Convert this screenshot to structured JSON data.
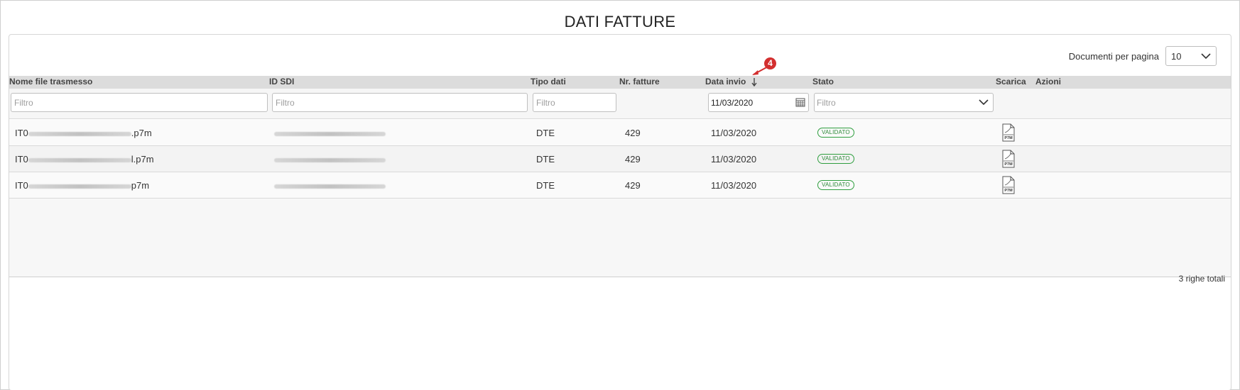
{
  "page": {
    "title": "DATI FATTURE"
  },
  "pagination": {
    "label": "Documenti per pagina",
    "selected": "10"
  },
  "columns": {
    "file_name": "Nome file trasmesso",
    "id_sdi": "ID SDI",
    "tipo_dati": "Tipo dati",
    "nr_fatture": "Nr. fatture",
    "data_invio": "Data invio",
    "stato": "Stato",
    "scarica": "Scarica",
    "azioni": "Azioni"
  },
  "sort_annotation": {
    "marker": "4",
    "color": "#d32f2f"
  },
  "filters": {
    "file_name_placeholder": "Filtro",
    "id_sdi_placeholder": "Filtro",
    "tipo_dati_placeholder": "Filtro",
    "data_invio_value": "11/03/2020",
    "stato_placeholder": "Filtro"
  },
  "rows": [
    {
      "file_prefix": "IT0",
      "file_suffix": ".p7m",
      "tipo": "DTE",
      "nr": "429",
      "data": "11/03/2020",
      "stato": "VALIDATO",
      "download_icon": "p7m-file-icon",
      "download_label": "P7M"
    },
    {
      "file_prefix": "IT0",
      "file_suffix": "l.p7m",
      "tipo": "DTE",
      "nr": "429",
      "data": "11/03/2020",
      "stato": "VALIDATO",
      "download_icon": "p7m-file-icon",
      "download_label": "P7M"
    },
    {
      "file_prefix": "IT0",
      "file_suffix": "p7m",
      "tipo": "DTE",
      "nr": "429",
      "data": "11/03/2020",
      "stato": "VALIDATO",
      "download_icon": "p7m-file-icon",
      "download_label": "P7M"
    }
  ],
  "footer": {
    "total": "3 righe totali"
  },
  "colors": {
    "status_green": "#2e8b3a",
    "header_bg": "#dcdcdc"
  }
}
